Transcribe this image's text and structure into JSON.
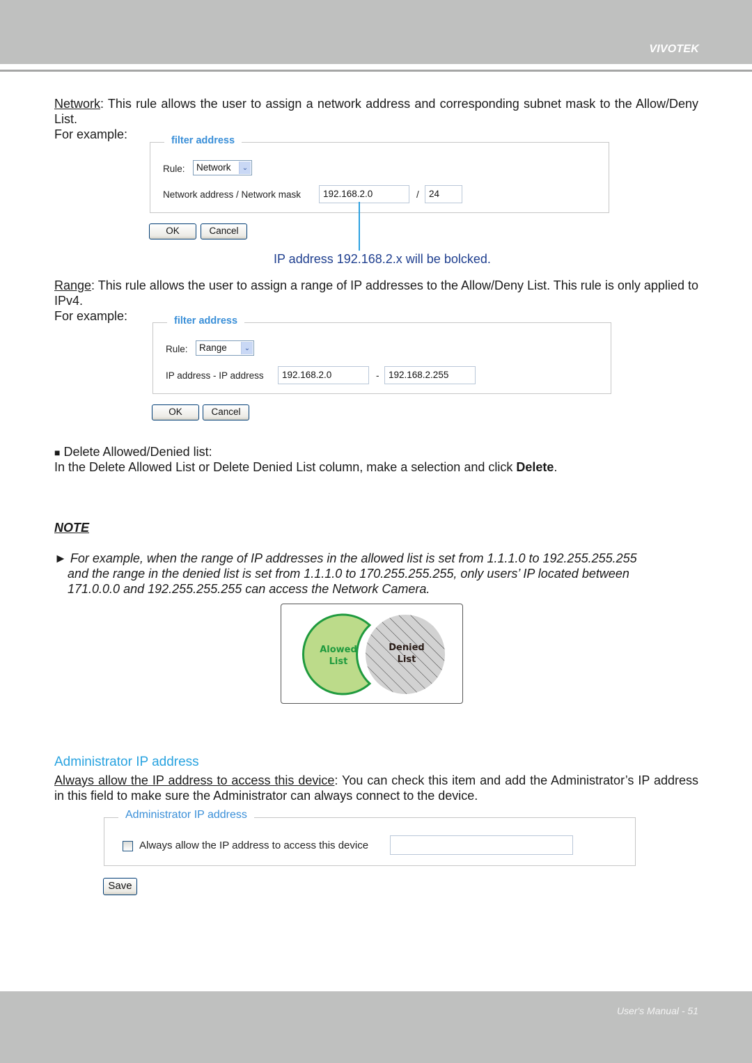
{
  "header": {
    "brand": "VIVOTEK"
  },
  "footer": {
    "page_label": "User's Manual - 51"
  },
  "network_section": {
    "term": "Network",
    "text_after_term": ": This rule allows the user to assign a network address and corresponding subnet mask to the Allow/Deny List.",
    "example_label": "For example:",
    "form": {
      "legend": "filter address",
      "rule_label": "Rule:",
      "rule_value": "Network",
      "field_label": "Network address / Network mask",
      "network_address": "192.168.2.0",
      "separator": "/",
      "network_mask": "24",
      "ok_label": "OK",
      "cancel_label": "Cancel"
    },
    "callout": "IP address 192.168.2.x will be bolcked."
  },
  "range_section": {
    "term": "Range",
    "text_after_term": ": This rule allows the user to assign a range of IP addresses to the Allow/Deny List. This rule is only applied to IPv4.",
    "example_label": "For example:",
    "form": {
      "legend": "filter address",
      "rule_label": "Rule:",
      "rule_value": "Range",
      "field_label": "IP address - IP address",
      "start_ip": "192.168.2.0",
      "separator": "-",
      "end_ip": "192.168.2.255",
      "ok_label": "OK",
      "cancel_label": "Cancel"
    }
  },
  "delete_section": {
    "bullet": "■",
    "heading": "Delete Allowed/Denied list:",
    "text_before": "In the Delete Allowed List or Delete Denied List column, make a selection and click ",
    "bold_word": "Delete",
    "text_after": "."
  },
  "note": {
    "title": "NOTE",
    "arrow": "►",
    "line1": "For example, when the range of IP addresses in the allowed list is set from 1.1.1.0 to 192.255.255.255",
    "line2": "and the range in the denied list is set from 1.1.1.0 to 170.255.255.255, only users’ IP located between",
    "line3": "171.0.0.0 and 192.255.255.255 can access the Network Camera."
  },
  "venn": {
    "allowed_label_1": "Alowed",
    "allowed_label_2": "List",
    "denied_label_1": "Denied",
    "denied_label_2": "List",
    "allowed_fill": "#bcdb8a",
    "allowed_stroke": "#1f9a3e",
    "denied_fill": "#d2d2d2"
  },
  "admin_section": {
    "title": "Administrator IP address",
    "term": "Always allow the IP address to access this device",
    "text_after_term": ": You can check this item and add the Administrator’s IP address in this field to make sure the Administrator can always connect to the device.",
    "form": {
      "legend": "Administrator IP address",
      "checkbox_label": "Always allow the IP address to access this device",
      "checked": false,
      "ip_value": "",
      "save_label": "Save"
    }
  }
}
